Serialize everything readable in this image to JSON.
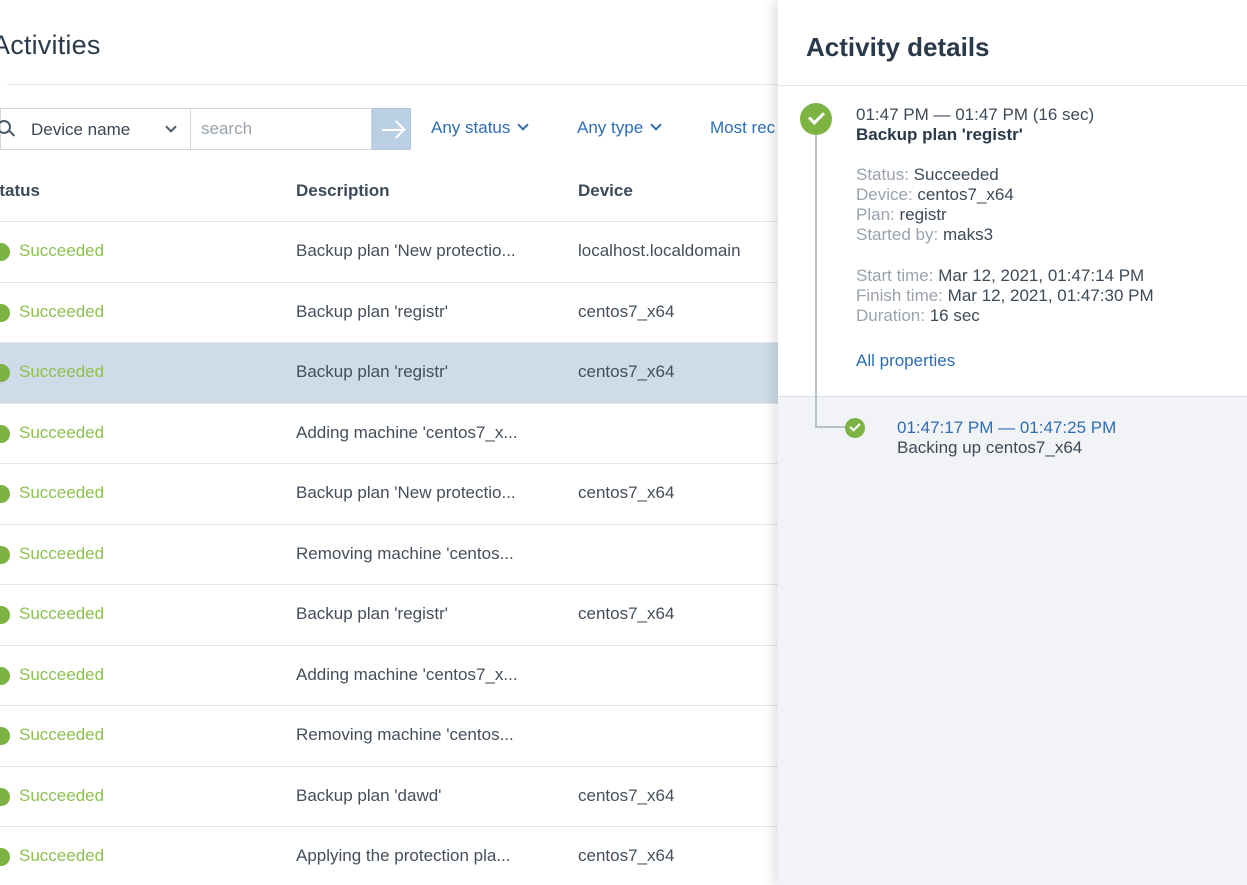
{
  "activities": {
    "title": "Activities",
    "filters": {
      "device_combo_label": "Device name",
      "search_placeholder": "search",
      "status_filter": "Any status",
      "type_filter": "Any type",
      "sort_filter": "Most rec"
    },
    "columns": {
      "status": "Status",
      "description": "Description",
      "device": "Device"
    },
    "rows": [
      {
        "status": "Succeeded",
        "description": "Backup plan 'New protectio...",
        "device": "localhost.localdomain"
      },
      {
        "status": "Succeeded",
        "description": "Backup plan 'registr'",
        "device": "centos7_x64"
      },
      {
        "status": "Succeeded",
        "description": "Backup plan 'registr'",
        "device": "centos7_x64"
      },
      {
        "status": "Succeeded",
        "description": "Adding machine 'centos7_x...",
        "device": ""
      },
      {
        "status": "Succeeded",
        "description": "Backup plan 'New protectio...",
        "device": "centos7_x64"
      },
      {
        "status": "Succeeded",
        "description": "Removing machine 'centos...",
        "device": ""
      },
      {
        "status": "Succeeded",
        "description": "Backup plan 'registr'",
        "device": "centos7_x64"
      },
      {
        "status": "Succeeded",
        "description": "Adding machine 'centos7_x...",
        "device": ""
      },
      {
        "status": "Succeeded",
        "description": "Removing machine 'centos...",
        "device": ""
      },
      {
        "status": "Succeeded",
        "description": "Backup plan 'dawd'",
        "device": "centos7_x64"
      },
      {
        "status": "Succeeded",
        "description": "Applying the protection pla...",
        "device": "centos7_x64"
      }
    ]
  },
  "details": {
    "title": "Activity details",
    "event": {
      "time": "01:47 PM — 01:47 PM (16 sec)",
      "title": "Backup plan 'registr'",
      "status_label": "Status:",
      "status_value": "Succeeded",
      "device_label": "Device:",
      "device_value": "centos7_x64",
      "plan_label": "Plan:",
      "plan_value": "registr",
      "started_by_label": "Started by:",
      "started_by_value": "maks3",
      "start_time_label": "Start time:",
      "start_time_value": "Mar 12, 2021, 01:47:14 PM",
      "finish_time_label": "Finish time:",
      "finish_time_value": "Mar 12, 2021, 01:47:30 PM",
      "duration_label": "Duration:",
      "duration_value": "16 sec",
      "all_properties_link": "All properties"
    },
    "sub_event": {
      "time": "01:47:17 PM — 01:47:25 PM",
      "title": "Backing up centos7_x64"
    }
  },
  "colors": {
    "success": "#7cb342",
    "link": "#2d6db5",
    "selected_row": "#cfdbe8"
  }
}
